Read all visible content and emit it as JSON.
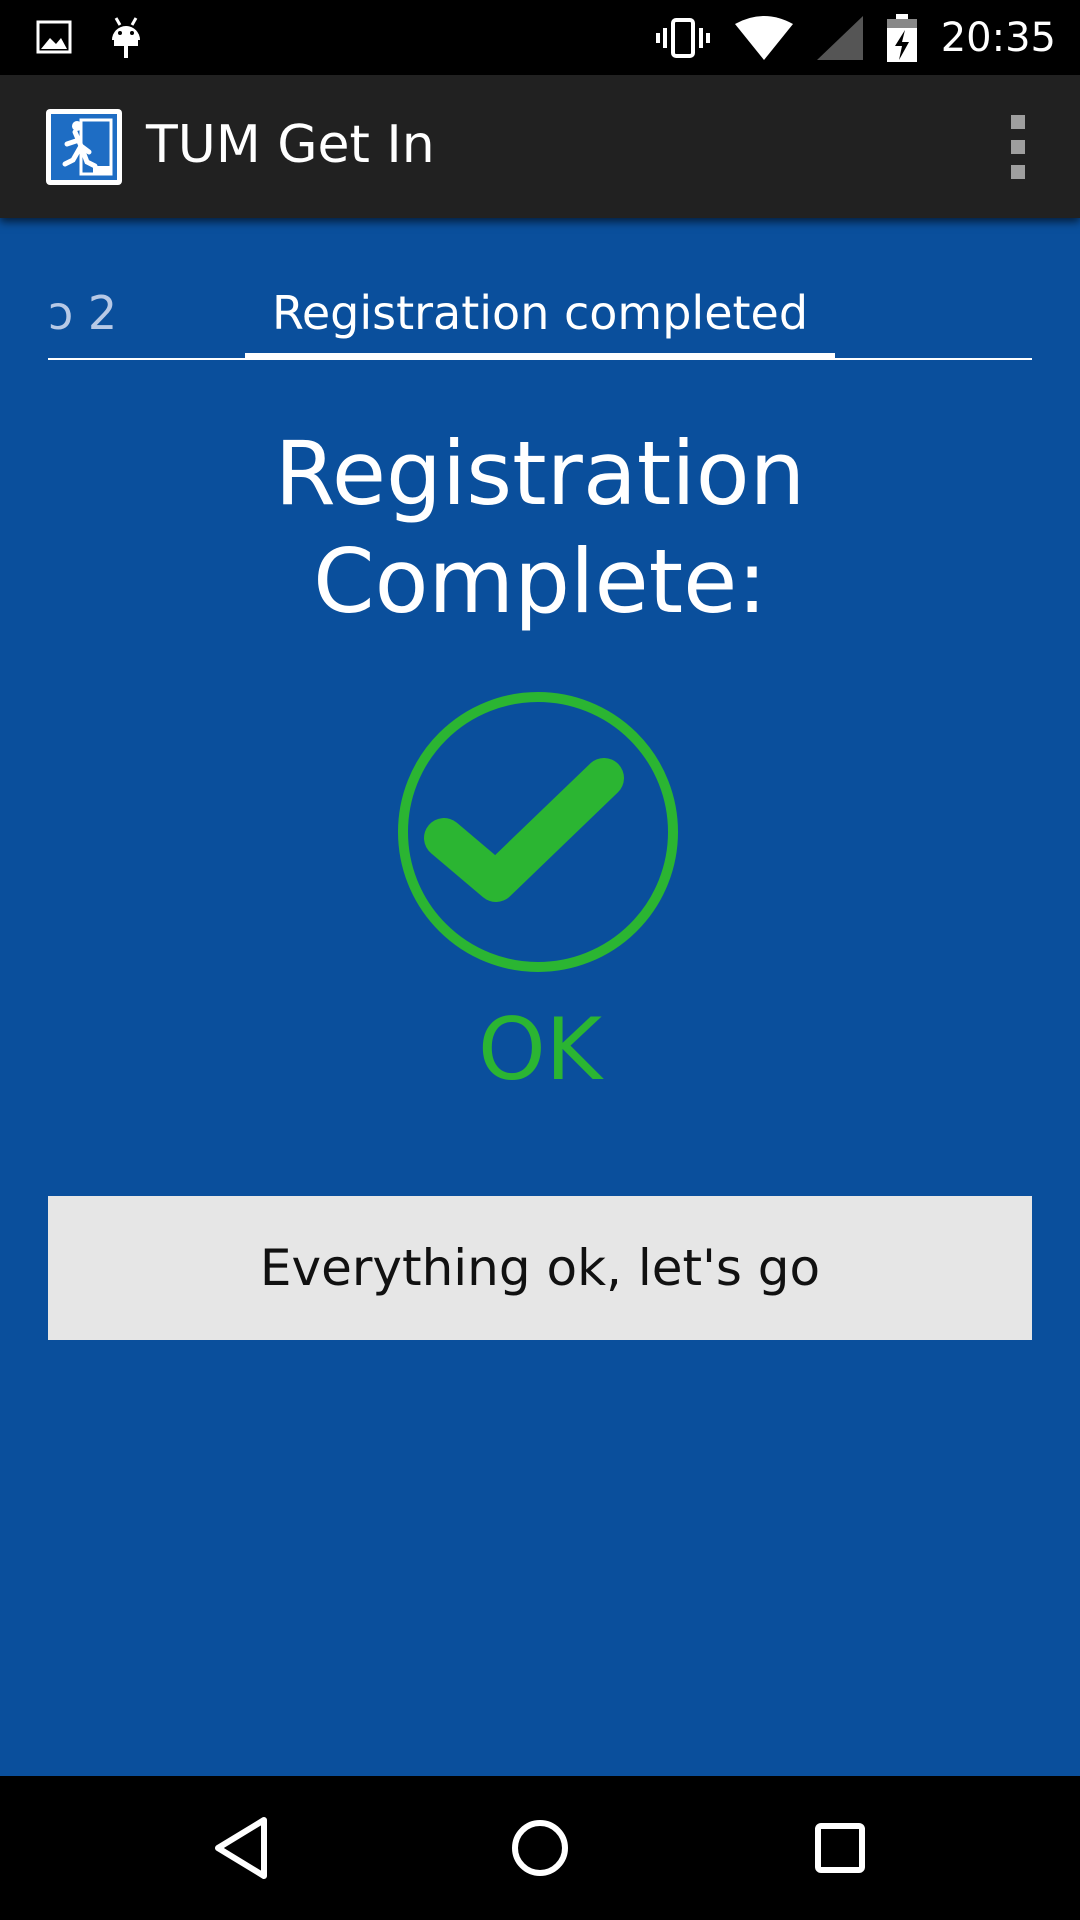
{
  "status_bar": {
    "time": "20:35",
    "icons": [
      "image-icon",
      "android-icon",
      "vibrate-icon",
      "wifi-icon",
      "cell-signal-icon",
      "battery-charging-icon"
    ]
  },
  "action_bar": {
    "title": "TUM Get In",
    "logo_icon": "emergency-exit-icon",
    "menu_icon": "overflow-menu-icon"
  },
  "tabs": {
    "previous_label": "ɔ 2",
    "current_label": "Registration completed"
  },
  "main": {
    "heading_line1": "Registration",
    "heading_line2": "Complete:",
    "status_icon": "checkmark-circle-icon",
    "status_text": "OK",
    "status_color": "#2bb532",
    "button_label": "Everything ok, let's go"
  },
  "colors": {
    "background": "#0a4f9c",
    "action_bar": "#212121",
    "button": "#e6e6e6"
  },
  "nav_bar": {
    "icons": [
      "back-icon",
      "home-icon",
      "recents-icon"
    ]
  }
}
